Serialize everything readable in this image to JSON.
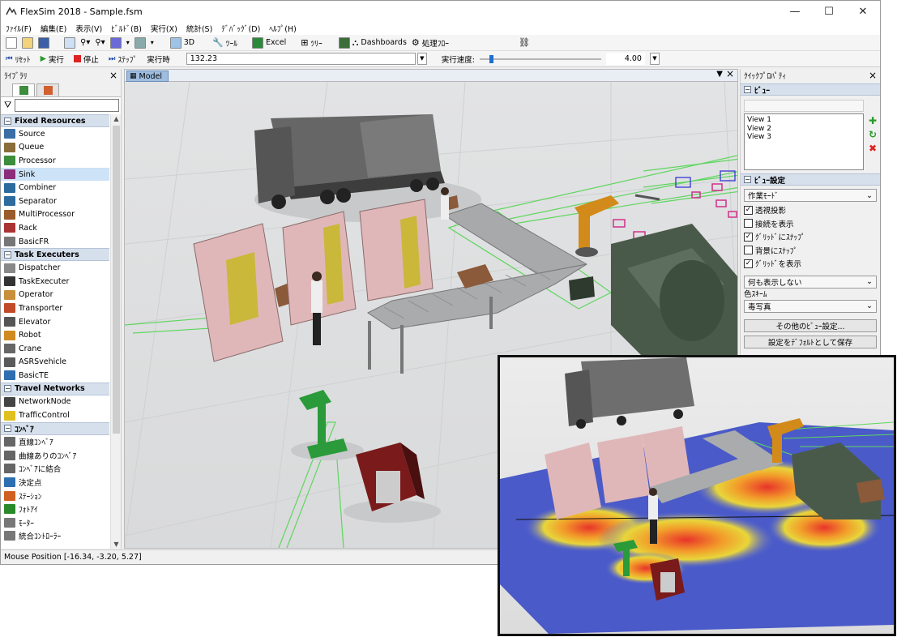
{
  "window": {
    "title": "FlexSim 2018 - Sample.fsm",
    "minimize": "—",
    "maximize": "☐",
    "close": "✕"
  },
  "menu": [
    "ﾌｧｲﾙ(F)",
    "編集(E)",
    "表示(V)",
    "ﾋﾞﾙﾄﾞ(B)",
    "実行(X)",
    "統計(S)",
    "ﾃﾞﾊﾞｯｸﾞ(D)",
    "ﾍﾙﾌﾟ(H)"
  ],
  "toolbar": {
    "view3d": "3D",
    "tools": "ﾂｰﾙ",
    "excel": "Excel",
    "tree": "ﾂﾘｰ",
    "dashboards": "Dashboards",
    "flow": "処理ﾌﾛｰ"
  },
  "runbar": {
    "reset": "ﾘｾｯﾄ",
    "run": "実行",
    "stop": "停止",
    "step": "ｽﾃｯﾌﾟ",
    "runtime_label": "実行時",
    "runtime_value": "132.23",
    "speed_label": "実行速度:",
    "speed_value": "4.00",
    "speed_fraction": 0.08
  },
  "library": {
    "title": "ﾗｲﾌﾞﾗﾘ",
    "close": "×",
    "categories": [
      {
        "name": "Fixed Resources",
        "toggle": "−",
        "items": [
          {
            "label": "Source",
            "color": "#3a6ea5"
          },
          {
            "label": "Queue",
            "color": "#8a6d3b"
          },
          {
            "label": "Processor",
            "color": "#3c8d3c"
          },
          {
            "label": "Sink",
            "color": "#8b2d7a",
            "selected": true
          },
          {
            "label": "Combiner",
            "color": "#2d6b9e"
          },
          {
            "label": "Separator",
            "color": "#2d6b9e"
          },
          {
            "label": "MultiProcessor",
            "color": "#9a5a2a"
          },
          {
            "label": "Rack",
            "color": "#a33"
          },
          {
            "label": "BasicFR",
            "color": "#777"
          }
        ]
      },
      {
        "name": "Task Executers",
        "toggle": "−",
        "items": [
          {
            "label": "Dispatcher",
            "color": "#888"
          },
          {
            "label": "TaskExecuter",
            "color": "#333"
          },
          {
            "label": "Operator",
            "color": "#c8903a"
          },
          {
            "label": "Transporter",
            "color": "#c14a2a"
          },
          {
            "label": "Elevator",
            "color": "#555"
          },
          {
            "label": "Robot",
            "color": "#d08a20"
          },
          {
            "label": "Crane",
            "color": "#666"
          },
          {
            "label": "ASRSvehicle",
            "color": "#5a5a5a"
          },
          {
            "label": "BasicTE",
            "color": "#2d6fb0"
          }
        ]
      },
      {
        "name": "Travel Networks",
        "toggle": "−",
        "items": [
          {
            "label": "NetworkNode",
            "color": "#444"
          },
          {
            "label": "TrafficControl",
            "color": "#e0c020"
          }
        ]
      },
      {
        "name": "ｺﾝﾍﾞｱ",
        "toggle": "−",
        "items": [
          {
            "label": "直線ｺﾝﾍﾞｱ",
            "color": "#666"
          },
          {
            "label": "曲線ありのｺﾝﾍﾞｱ",
            "color": "#666"
          },
          {
            "label": "ｺﾝﾍﾞｱに結合",
            "color": "#666"
          },
          {
            "label": "決定点",
            "color": "#2d6fb0"
          },
          {
            "label": "ｽﾃｰｼｮﾝ",
            "color": "#d06020"
          },
          {
            "label": "ﾌｫﾄｱｲ",
            "color": "#2a8a2a"
          },
          {
            "label": "ﾓｰﾀｰ",
            "color": "#777"
          },
          {
            "label": "統合ｺﾝﾄﾛｰﾗｰ",
            "color": "#777"
          }
        ]
      }
    ]
  },
  "view": {
    "tab": "Model",
    "dropdown": "▼",
    "close": "×"
  },
  "props": {
    "title": "ｸｲｯｸﾌﾟﾛﾊﾟﾃｨ",
    "close": "×",
    "section_view": "ﾋﾞｭｰ",
    "views": [
      "View 1",
      "View 2",
      "View 3"
    ],
    "section_settings": "ﾋﾞｭｰ設定",
    "mode": "作業ﾓｰﾄﾞ",
    "checks": [
      {
        "label": "透視投影",
        "checked": true
      },
      {
        "label": "接続を表示",
        "checked": false
      },
      {
        "label": "ｸﾞﾘｯﾄﾞにｽﾅｯﾌﾟ",
        "checked": true
      },
      {
        "label": "背景にｽﾅｯﾌﾟ",
        "checked": false
      },
      {
        "label": "ｸﾞﾘｯﾄﾞを表示",
        "checked": true
      }
    ],
    "show": "何も表示しない",
    "color_scheme_label": "色ｽｷｰﾑ",
    "color_scheme": "毒写真",
    "btn_more": "その他のﾋﾞｭｰ設定...",
    "btn_default": "設定をﾃﾞﾌｫﾙﾄとして保存"
  },
  "status": {
    "mouse": "Mouse Position [-16.34, -3.20, 5.27]"
  }
}
